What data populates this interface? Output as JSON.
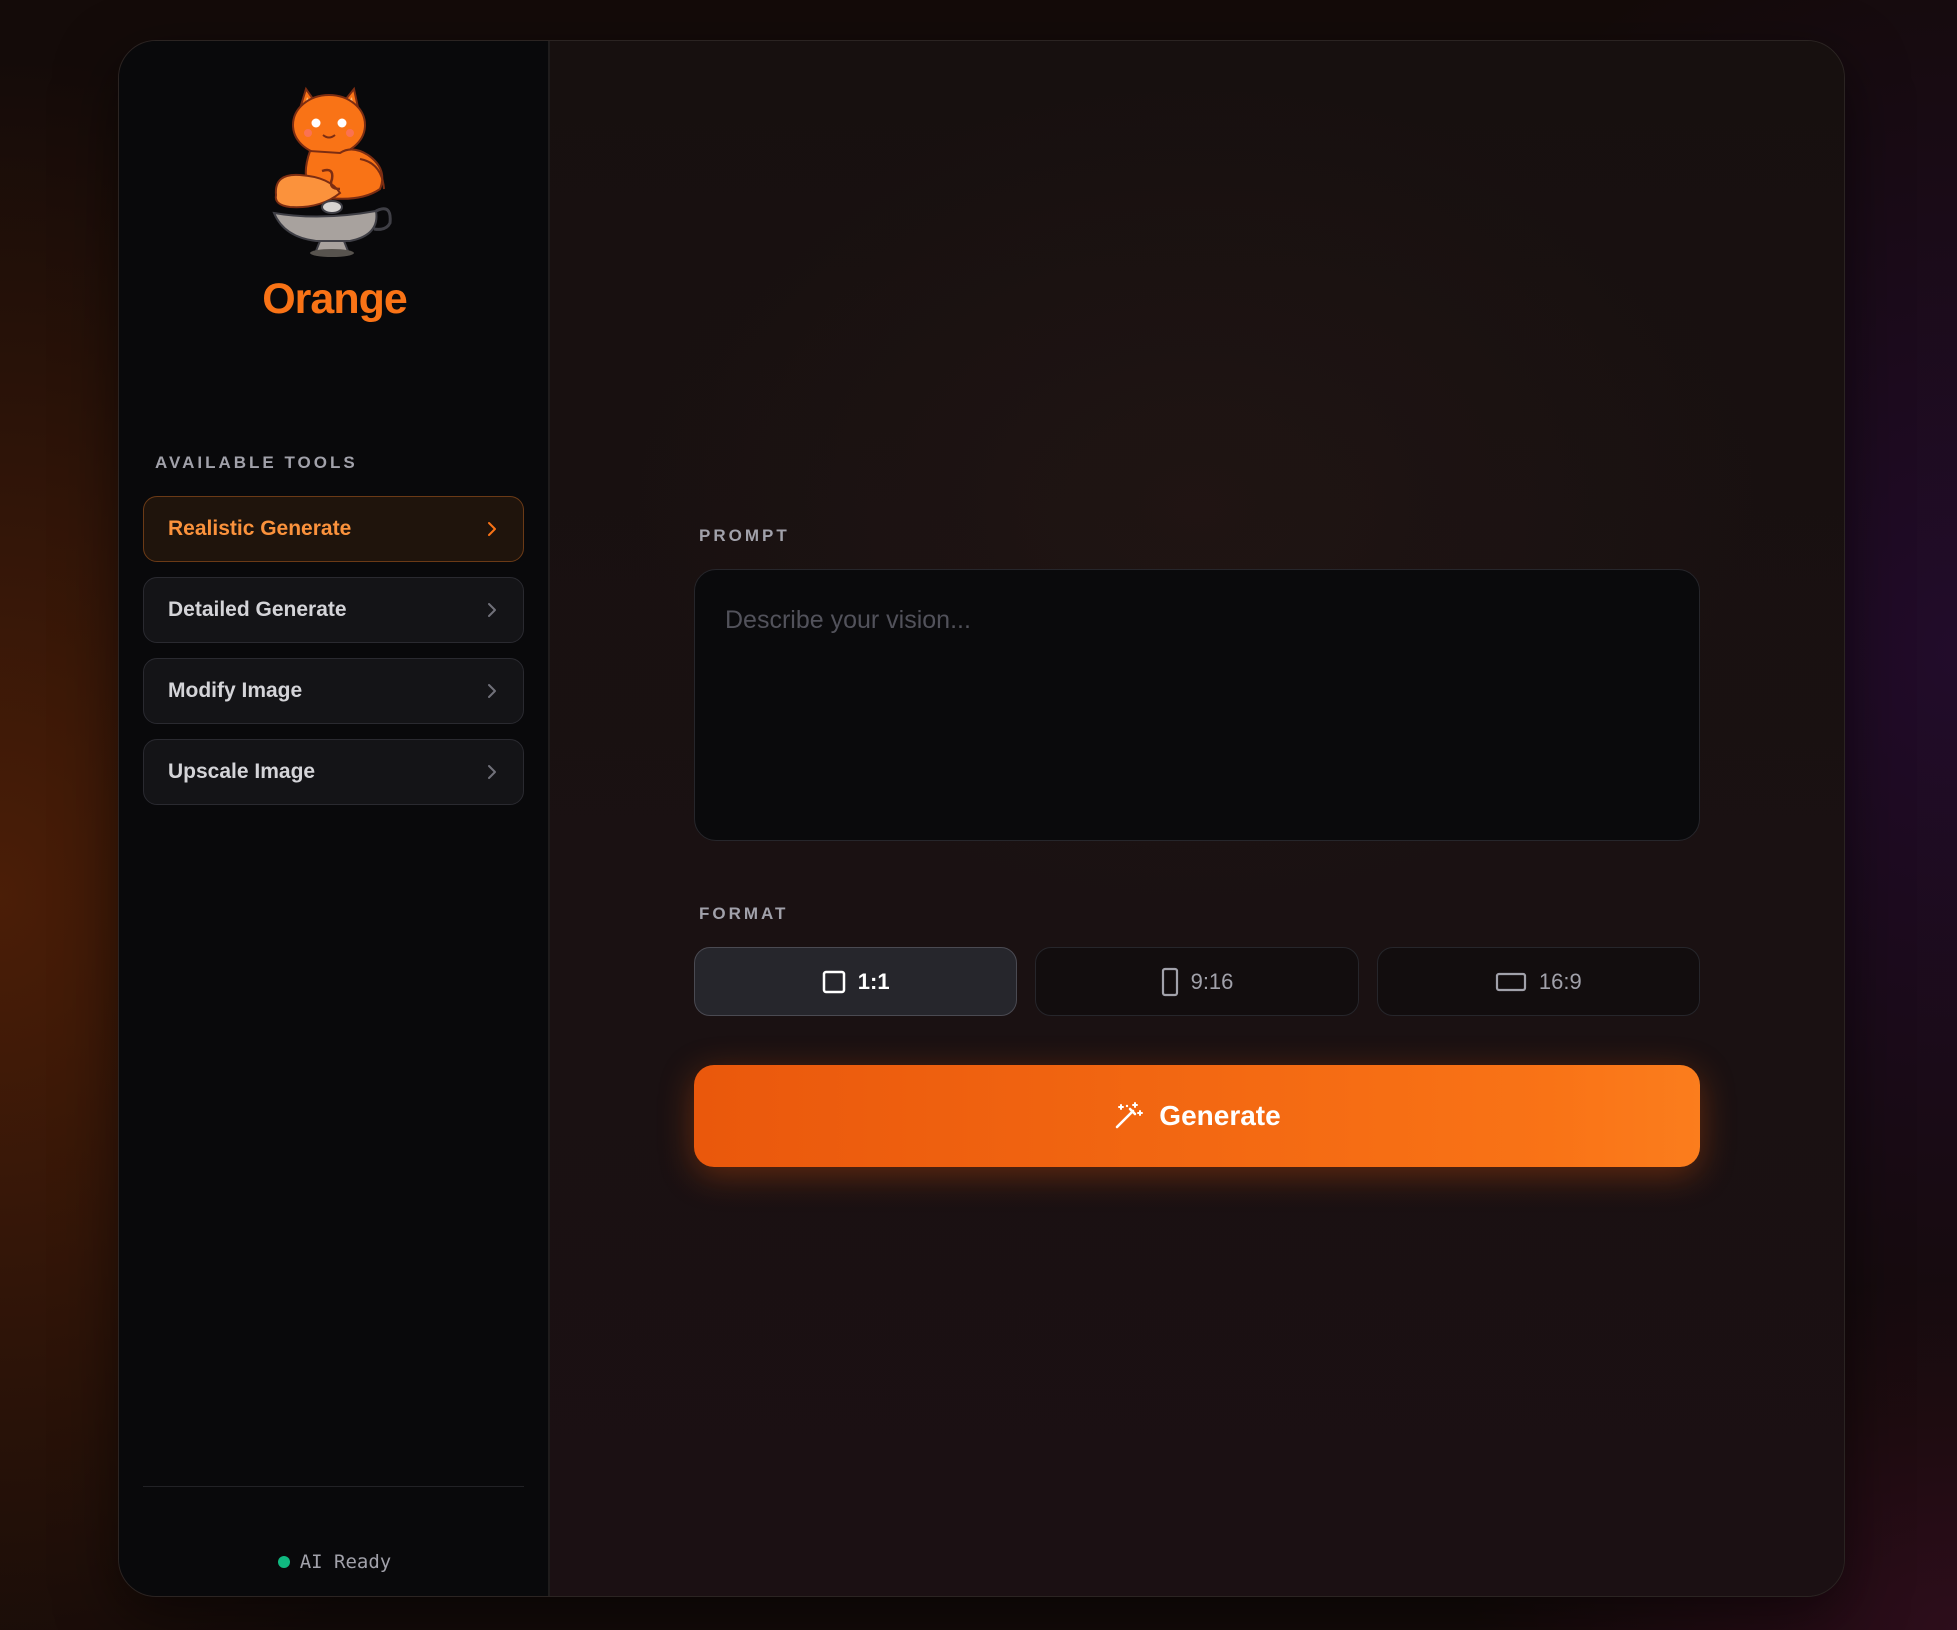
{
  "brand": {
    "name": "Orange",
    "logo_icon": "orange-cat-genie-lamp-logo"
  },
  "sidebar": {
    "section_label": "AVAILABLE TOOLS",
    "tools": [
      {
        "label": "Realistic Generate",
        "active": true,
        "icon": "chevron-right-icon"
      },
      {
        "label": "Detailed Generate",
        "active": false,
        "icon": "chevron-right-icon"
      },
      {
        "label": "Modify Image",
        "active": false,
        "icon": "chevron-right-icon"
      },
      {
        "label": "Upscale Image",
        "active": false,
        "icon": "chevron-right-icon"
      }
    ],
    "status": {
      "text": "AI Ready",
      "color": "#10b981"
    }
  },
  "main": {
    "prompt": {
      "label": "PROMPT",
      "placeholder": "Describe your vision...",
      "value": ""
    },
    "format": {
      "label": "FORMAT",
      "options": [
        {
          "label": "1:1",
          "icon": "square-icon",
          "selected": true
        },
        {
          "label": "9:16",
          "icon": "portrait-icon",
          "selected": false
        },
        {
          "label": "16:9",
          "icon": "landscape-icon",
          "selected": false
        }
      ]
    },
    "generate": {
      "label": "Generate",
      "icon": "magic-wand-icon"
    }
  },
  "colors": {
    "accent": "#f97316",
    "accent_dark": "#ea580c",
    "status_ok": "#10b981"
  }
}
